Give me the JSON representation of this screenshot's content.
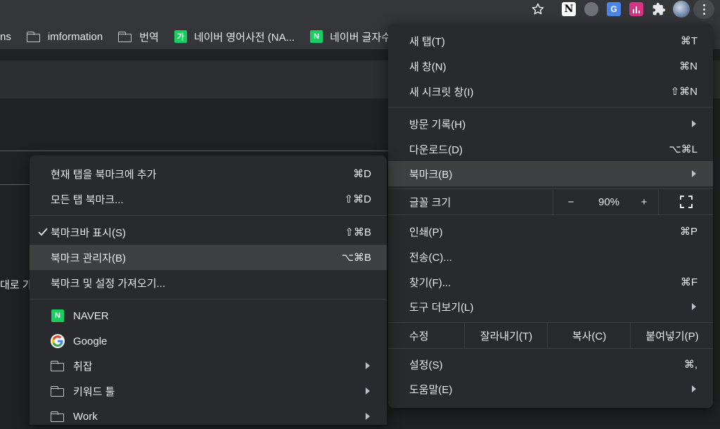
{
  "colors": {
    "accent_green": "#19ce60",
    "menu_bg": "#292a2d",
    "highlight": "#3f4042"
  },
  "toolbar": {
    "icons": [
      "star-icon",
      "notion-icon",
      "share-extension-icon",
      "translate-extension-icon",
      "chart-extension-icon",
      "puzzle-extensions-icon",
      "profile-avatar",
      "kebab-menu-icon"
    ],
    "translate_glyph": "G",
    "notion_glyph": "N"
  },
  "bookmarks_bar": {
    "items": [
      {
        "label": "ns",
        "icon": "none"
      },
      {
        "label": "imformation",
        "icon": "folder-icon"
      },
      {
        "label": "번역",
        "icon": "folder-icon"
      },
      {
        "label": "네이버 영어사전 (NA...",
        "icon": "naver-dictionary-icon",
        "glyph": "가"
      },
      {
        "label": "네이버 글자수",
        "icon": "naver-icon",
        "glyph": "N"
      }
    ]
  },
  "page": {
    "fragment": "대로 가"
  },
  "main_menu": {
    "new_tab": {
      "label": "새 탭(T)",
      "shortcut": "⌘T"
    },
    "new_window": {
      "label": "새 창(N)",
      "shortcut": "⌘N"
    },
    "incognito": {
      "label": "새 시크릿 창(I)",
      "shortcut": "⇧⌘N"
    },
    "history": {
      "label": "방문 기록(H)"
    },
    "downloads": {
      "label": "다운로드(D)",
      "shortcut": "⌥⌘L"
    },
    "bookmarks": {
      "label": "북마크(B)"
    },
    "zoom": {
      "label": "글꼴 크기",
      "minus": "−",
      "value": "90%",
      "plus": "+"
    },
    "print": {
      "label": "인쇄(P)",
      "shortcut": "⌘P"
    },
    "cast": {
      "label": "전송(C)..."
    },
    "find": {
      "label": "찾기(F)...",
      "shortcut": "⌘F"
    },
    "more_tools": {
      "label": "도구 더보기(L)"
    },
    "edit": {
      "label": "수정",
      "cut": "잘라내기(T)",
      "copy": "복사(C)",
      "paste": "붙여넣기(P)"
    },
    "settings": {
      "label": "설정(S)",
      "shortcut": "⌘,"
    },
    "help": {
      "label": "도움말(E)"
    }
  },
  "bookmarks_submenu": {
    "bookmark_this_tab": {
      "label": "현재 탭을 북마크에 추가",
      "shortcut": "⌘D"
    },
    "bookmark_all_tabs": {
      "label": "모든 탭 북마크...",
      "shortcut": "⇧⌘D"
    },
    "show_bookmarks_bar": {
      "label": "북마크바 표시(S)",
      "shortcut": "⇧⌘B",
      "checked": true
    },
    "bookmark_manager": {
      "label": "북마크 관리자(B)",
      "shortcut": "⌥⌘B"
    },
    "import": {
      "label": "북마크 및 설정 가져오기..."
    },
    "naver": {
      "label": "NAVER",
      "glyph": "N"
    },
    "google": {
      "label": "Google",
      "glyph": "G"
    },
    "folder_chwijap": {
      "label": "취잡"
    },
    "folder_keyword": {
      "label": "키워드 툴"
    },
    "folder_work": {
      "label": "Work"
    }
  }
}
